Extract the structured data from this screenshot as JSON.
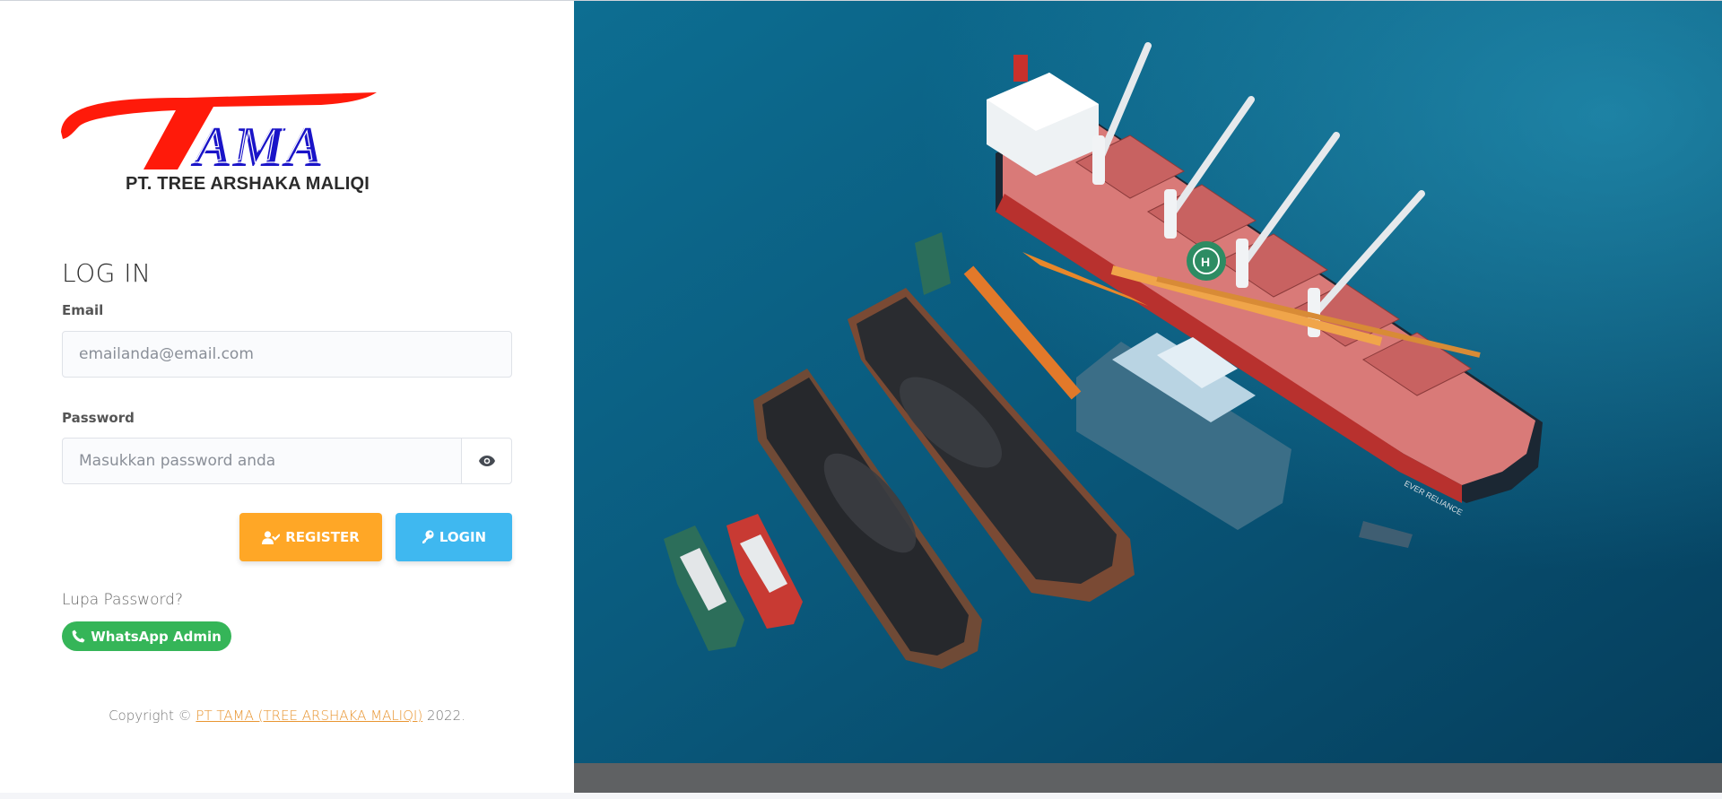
{
  "brand": {
    "logo_text": "TAMA",
    "company_name": "PT. TREE ARSHAKA MALIQI",
    "logo_red": "#ff1a0a",
    "logo_blue": "#1a14c8"
  },
  "login": {
    "title": "LOG IN",
    "email_label": "Email",
    "email_placeholder": "emailanda@email.com",
    "email_value": "",
    "password_label": "Password",
    "password_placeholder": "Masukkan password anda",
    "password_value": "",
    "toggle_password_icon": "eye-icon",
    "register_label": "REGISTER",
    "register_icon": "user-check-icon",
    "login_label": "LOGIN",
    "login_icon": "key-icon",
    "forgot_password": "Lupa Password?",
    "whatsapp_label": "WhatsApp Admin",
    "whatsapp_icon": "phone-icon"
  },
  "footer": {
    "prefix": "Copyright ©",
    "company": "PT TAMA (TREE ARSHAKA MALIQI)",
    "year": "2022."
  },
  "colors": {
    "register_button": "#ffa726",
    "login_button": "#3fb8f0",
    "whatsapp_button": "#35b558",
    "copyright_link": "#e89531"
  },
  "hero_image": {
    "description_icon": "cargo-ship-photo"
  }
}
